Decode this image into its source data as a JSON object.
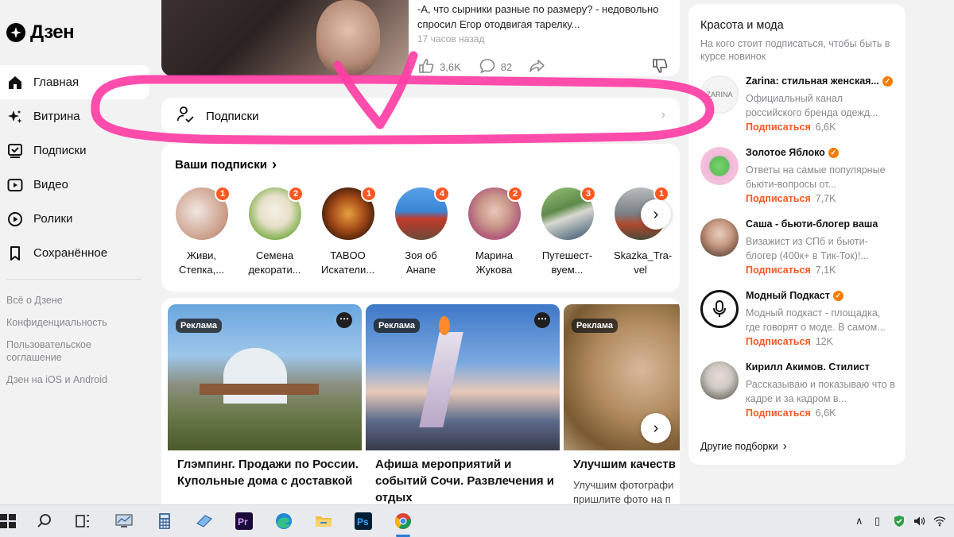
{
  "brand": {
    "name": "Дзен"
  },
  "nav": {
    "items": [
      {
        "label": "Главная",
        "icon": "home-icon",
        "active": true
      },
      {
        "label": "Витрина",
        "icon": "sparkle-icon"
      },
      {
        "label": "Подписки",
        "icon": "subscriptions-icon"
      },
      {
        "label": "Видео",
        "icon": "video-icon"
      },
      {
        "label": "Ролики",
        "icon": "shorts-icon"
      },
      {
        "label": "Сохранённое",
        "icon": "bookmark-icon"
      }
    ],
    "links": [
      "Всё о Дзене",
      "Конфиденциальность",
      "Пользовательское соглашение",
      "Дзен на iOS и Android"
    ]
  },
  "post": {
    "text": "-А, что сырники разные по размеру? - недовольно спросил Егор отодвигая тарелку...",
    "time": "17 часов назад",
    "likes": "3,6K",
    "comments": "82"
  },
  "subs_bar": {
    "label": "Подписки"
  },
  "your_subs": {
    "title": "Ваши подписки",
    "channels": [
      {
        "name": "Живи, Степка,...",
        "badge": "1",
        "colors": [
          "#f1e7e1",
          "#c99b86"
        ]
      },
      {
        "name": "Семена декорати...",
        "badge": "2",
        "colors": [
          "#f5f1e6",
          "#7fae4a"
        ]
      },
      {
        "name": "TABOO Искатели...",
        "badge": "1",
        "colors": [
          "#2a1208",
          "#d97a24"
        ]
      },
      {
        "name": "Зоя об Анапе",
        "badge": "4",
        "colors": [
          "#3a86d6",
          "#c23a2a"
        ]
      },
      {
        "name": "Марина Жукова",
        "badge": "2",
        "colors": [
          "#e9d8dc",
          "#a6706b"
        ]
      },
      {
        "name": "Путешест-вуем...",
        "badge": "3",
        "colors": [
          "#5d8a4a",
          "#2f4f6a"
        ]
      },
      {
        "name": "Skazka_Tra-vel",
        "badge": "1",
        "colors": [
          "#7a7f84",
          "#b04a2f"
        ]
      }
    ]
  },
  "ads": [
    {
      "tag": "Реклама",
      "title": "Глэмпинг. Продажи по России. Купольные дома с доставкой",
      "desc": ""
    },
    {
      "tag": "Реклама",
      "title": "Афиша мероприятий и событий Сочи. Развлечения и отдых",
      "desc": ""
    },
    {
      "tag": "Реклама",
      "title": "Улучшим качеств",
      "desc": "Улучшим фотографи пришлите фото на п"
    }
  ],
  "right_panel": {
    "title": "Красота и мода",
    "subtitle": "На кого стоит подписаться, чтобы быть в курсе новинок",
    "items": [
      {
        "name": "Zarina: стильная женская...",
        "desc": "Официальный канал российского бренда одежд...",
        "subscribe": "Подписаться",
        "count": "6,6K",
        "colors": [
          "#f4f4f4",
          "#cfcfcf"
        ]
      },
      {
        "name": "Золотое Яблоко",
        "desc": "Ответы на самые популярные бьюти-вопросы от...",
        "subscribe": "Подписаться",
        "count": "7,7K",
        "colors": [
          "#f2b8d8",
          "#7bd36b"
        ]
      },
      {
        "name": "Саша - бьюти-блогер ваша",
        "desc": "Визажист из СПб и бьюти-блогер (400к+ в Тик-Ток)!...",
        "subscribe": "Подписаться",
        "count": "7,1K",
        "colors": [
          "#d9c2b2",
          "#6d4f3f"
        ]
      },
      {
        "name": "Модный Подкаст",
        "desc": "Модный подкаст - площадка, где говорят о моде. В самом...",
        "subscribe": "Подписаться",
        "count": "12K",
        "colors": [
          "#ffffff",
          "#111111"
        ]
      },
      {
        "name": "Кирилл Акимов. Стилист",
        "desc": "Рассказываю и показываю что в кадре и за кадром в...",
        "subscribe": "Подписаться",
        "count": "6,6K",
        "colors": [
          "#cfc9c4",
          "#6b6560"
        ]
      }
    ],
    "more": "Другие подборки"
  },
  "accent": "#ff5722",
  "annotation_color": "#ff3ea5"
}
